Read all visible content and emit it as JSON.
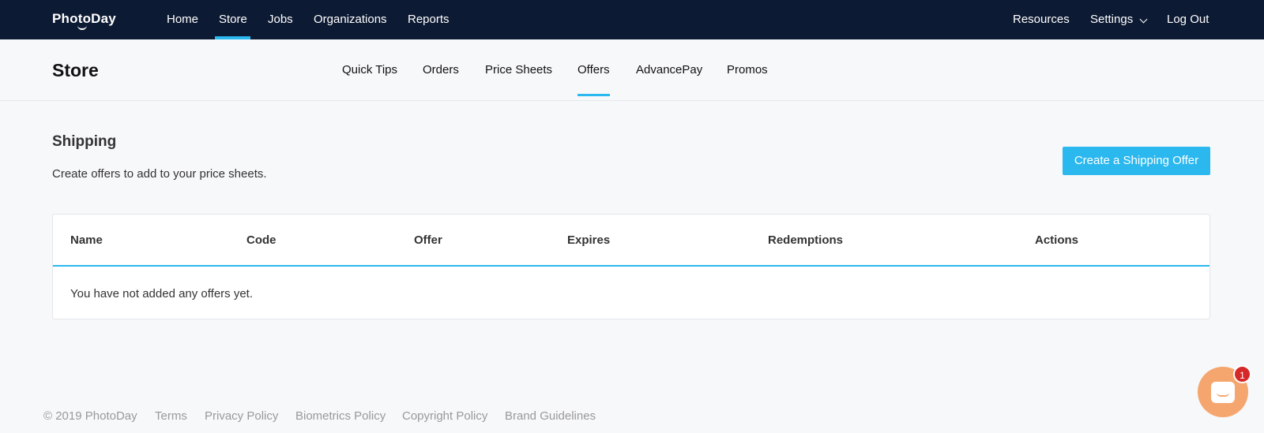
{
  "topnav": {
    "logo": "PhotoDay",
    "left_links": [
      "Home",
      "Store",
      "Jobs",
      "Organizations",
      "Reports"
    ],
    "active": "Store",
    "right_links": [
      "Resources",
      "Settings",
      "Log Out"
    ]
  },
  "subheader": {
    "title": "Store",
    "tabs": [
      "Quick Tips",
      "Orders",
      "Price Sheets",
      "Offers",
      "AdvancePay",
      "Promos"
    ],
    "active": "Offers"
  },
  "section": {
    "title": "Shipping",
    "description": "Create offers to add to your price sheets.",
    "create_button": "Create a Shipping Offer"
  },
  "table": {
    "columns": [
      "Name",
      "Code",
      "Offer",
      "Expires",
      "Redemptions",
      "Actions"
    ],
    "empty_message": "You have not added any offers yet."
  },
  "footer": {
    "copyright": "© 2019 PhotoDay",
    "links": [
      "Terms",
      "Privacy Policy",
      "Biometrics Policy",
      "Copyright Policy",
      "Brand Guidelines"
    ]
  },
  "chat": {
    "badge": "1"
  },
  "colors": {
    "nav_bg": "#0d1a33",
    "accent": "#2bb8ee",
    "chat": "#f5a66f",
    "badge": "#d62828"
  }
}
